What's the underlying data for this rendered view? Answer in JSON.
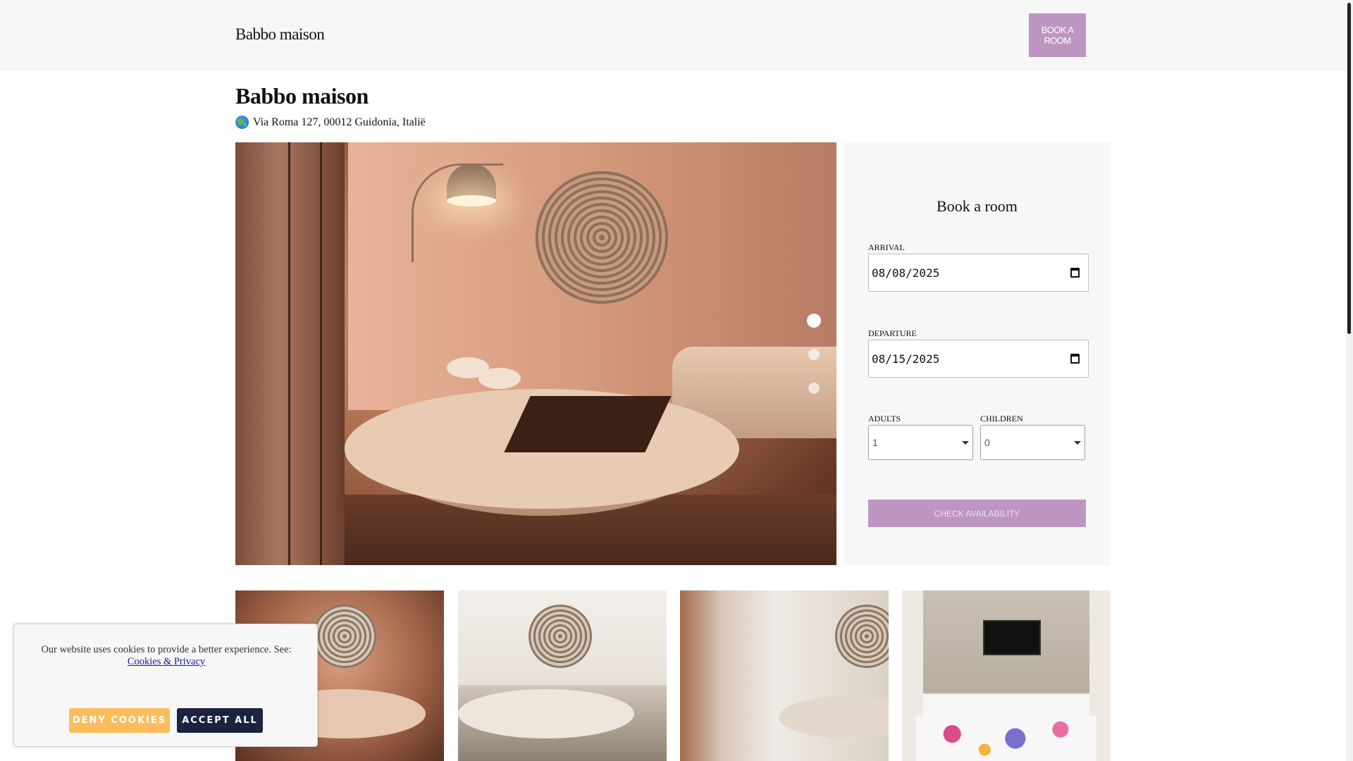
{
  "header": {
    "brand": "Babbo maison",
    "book_button": "BOOK A ROOM"
  },
  "property": {
    "title": "Babbo maison",
    "address": "Via Roma 127, 00012 Guidonia, Italië"
  },
  "gallery": {
    "slide_count": 3,
    "active_slide": 1
  },
  "booking": {
    "title": "Book a room",
    "arrival_label": "ARRIVAL",
    "arrival_value": "08/08/2025",
    "departure_label": "DEPARTURE",
    "departure_value": "08/15/2025",
    "adults_label": "ADULTS",
    "adults_value": "1",
    "children_label": "CHILDREN",
    "children_value": "0",
    "check_button": "CHECK AVAILABILITY"
  },
  "cookie_banner": {
    "text": "Our website uses cookies to provide a better experience. See:",
    "link": "Cookies & Privacy",
    "deny_button": "DENY COOKIES",
    "accept_button": "ACCEPT ALL"
  },
  "colors": {
    "accent": "#bd96c2",
    "deny": "#fbbd5c",
    "accept": "#1b2340"
  }
}
